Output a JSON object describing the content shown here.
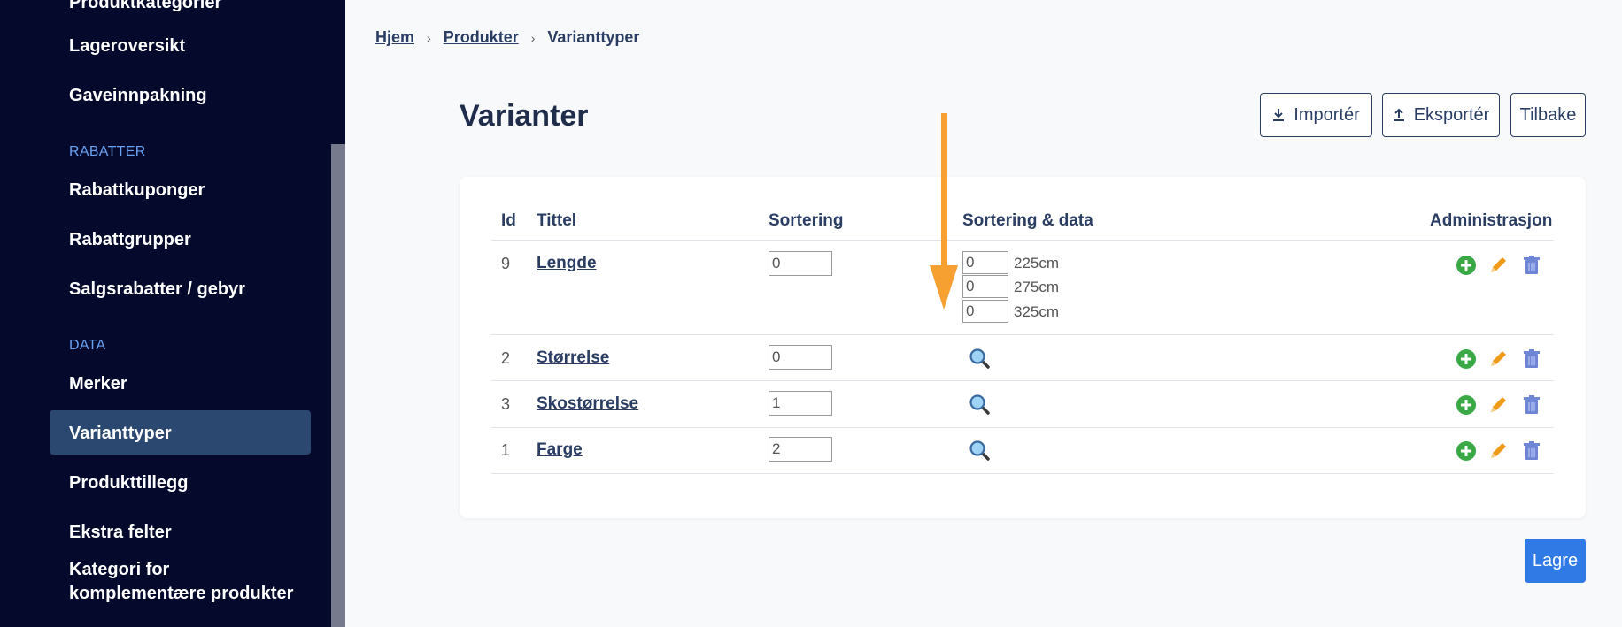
{
  "sidebar": {
    "items_top": [
      {
        "label": "Produktkategorier"
      },
      {
        "label": "Lageroversikt"
      },
      {
        "label": "Gaveinnpakning"
      }
    ],
    "section_rabatter": "RABATTER",
    "items_rabatter": [
      {
        "label": "Rabattkuponger"
      },
      {
        "label": "Rabattgrupper"
      },
      {
        "label": "Salgsrabatter / gebyr"
      }
    ],
    "section_data": "DATA",
    "items_data": [
      {
        "label": "Merker"
      },
      {
        "label": "Varianttyper",
        "active": true
      },
      {
        "label": "Produkttillegg"
      },
      {
        "label": "Ekstra felter"
      },
      {
        "label": "Kategori for komplementære produkter",
        "line1": "Kategori for",
        "line2": "komplementære produkter"
      }
    ]
  },
  "breadcrumb": {
    "home": "Hjem",
    "products": "Produkter",
    "current": "Varianttyper"
  },
  "page": {
    "title": "Varianter"
  },
  "toolbar": {
    "import_label": "Importér",
    "export_label": "Eksportér",
    "back_label": "Tilbake"
  },
  "table": {
    "headers": {
      "id": "Id",
      "title": "Tittel",
      "sort": "Sortering",
      "sort_data": "Sortering & data",
      "admin": "Administrasjon"
    },
    "rows": [
      {
        "id": "9",
        "title": "Lengde",
        "sort": "0",
        "values": [
          {
            "sort": "0",
            "label": "225cm"
          },
          {
            "sort": "0",
            "label": "275cm"
          },
          {
            "sort": "0",
            "label": "325cm"
          }
        ]
      },
      {
        "id": "2",
        "title": "Størrelse",
        "sort": "0"
      },
      {
        "id": "3",
        "title": "Skostørrelse",
        "sort": "1"
      },
      {
        "id": "1",
        "title": "Farge",
        "sort": "2"
      }
    ]
  },
  "save_label": "Lagre",
  "colors": {
    "sidebar_bg": "#050a2c",
    "sidebar_active": "#2b4870",
    "section_label": "#6aa2f2",
    "primary": "#2f7ae5",
    "annotation_arrow": "#f5a031",
    "add_icon": "#3aa845",
    "edit_icon": "#f09a1a",
    "delete_icon": "#6f86d6"
  }
}
